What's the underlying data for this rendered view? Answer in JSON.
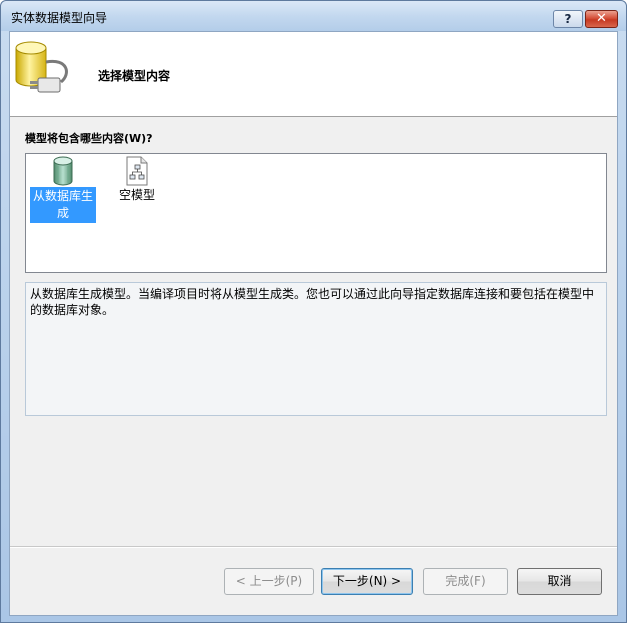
{
  "window": {
    "title": "实体数据模型向导",
    "help_glyph": "?",
    "close_glyph": "✕"
  },
  "header": {
    "title": "选择模型内容",
    "icon": "database-plug-icon"
  },
  "question_label": "模型将包含哪些内容(W)?",
  "templates": {
    "items": [
      {
        "label": "从数据库生成",
        "icon": "database-icon",
        "selected": true
      },
      {
        "label": "空模型",
        "icon": "empty-model-icon",
        "selected": false
      }
    ]
  },
  "description": "从数据库生成模型。当编译项目时将从模型生成类。您也可以通过此向导指定数据库连接和要包括在模型中的数据库对象。",
  "buttons": {
    "prev": "< 上一步(P)",
    "next": "下一步(N) >",
    "finish": "完成(F)",
    "cancel": "取消"
  },
  "colors": {
    "selection": "#3399ff",
    "close_button": "#c63a22",
    "titlebar": "#c3d8ef"
  }
}
